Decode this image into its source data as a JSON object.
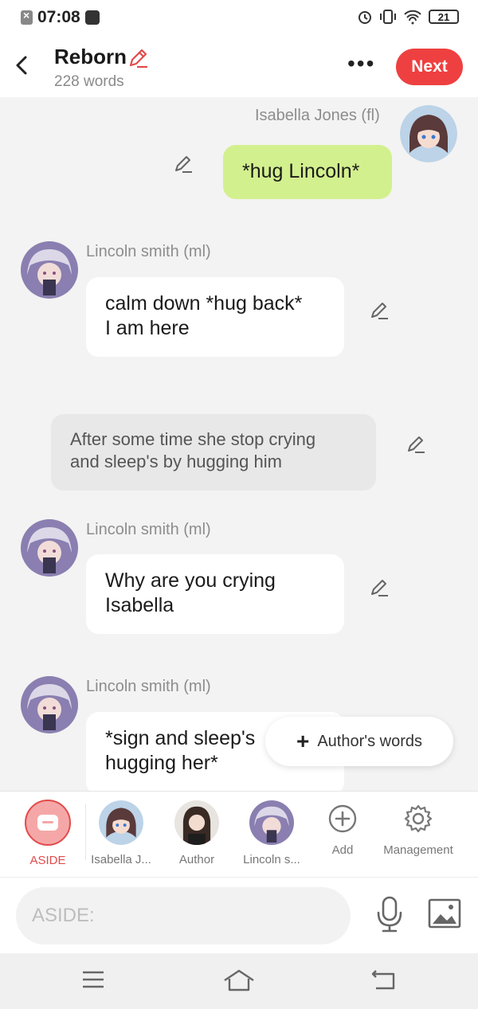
{
  "status_bar": {
    "time": "07:08",
    "battery": "21"
  },
  "header": {
    "title": "Reborn",
    "word_count": "228 words",
    "next_label": "Next",
    "more_label": "•••"
  },
  "messages": [
    {
      "type": "right",
      "name": "Isabella Jones (fl)",
      "text": "*hug Lincoln*"
    },
    {
      "type": "left",
      "name": "Lincoln smith (ml)",
      "text_lines": [
        "calm down *hug back*",
        "I am here"
      ]
    },
    {
      "type": "aside",
      "text_lines": [
        "After some time she stop crying",
        "and sleep's by hugging him"
      ]
    },
    {
      "type": "left",
      "name": "Lincoln smith (ml)",
      "text_lines": [
        "Why are you crying",
        "Isabella"
      ]
    },
    {
      "type": "left",
      "name": "Lincoln smith (ml)",
      "text_lines": [
        "*sign and sleep's",
        "hugging her*"
      ]
    }
  ],
  "authors_words": {
    "label": "Author's words"
  },
  "roles": [
    {
      "label": "ASIDE"
    },
    {
      "label": "Isabella J..."
    },
    {
      "label": "Author"
    },
    {
      "label": "Lincoln s..."
    },
    {
      "label": "Add",
      "icon": "add-circle-icon"
    },
    {
      "label": "Management",
      "icon": "gear-icon"
    }
  ],
  "input": {
    "placeholder": "ASIDE:"
  },
  "colors": {
    "accent": "#ee4040",
    "green_bubble": "#d3f08e",
    "aside_bubble": "#e8e8e8"
  }
}
